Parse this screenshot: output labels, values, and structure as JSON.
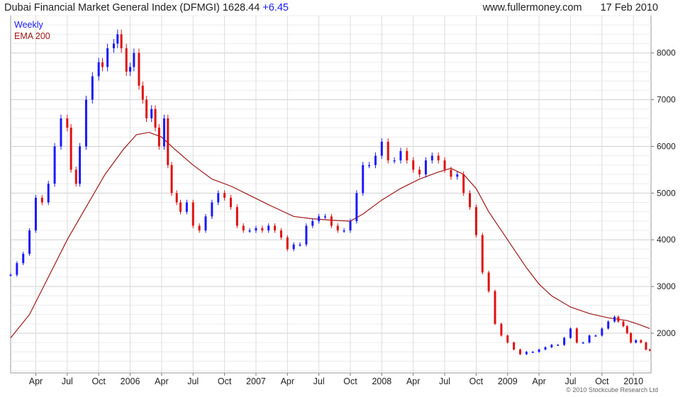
{
  "header": {
    "title": "Dubai Financial Market  General Index (DFMGI)",
    "last": "1628.44",
    "change": "+6.45",
    "site": "www.fullermoney.com",
    "date": "17 Feb 2010"
  },
  "footer": "© 2010 Stockcube Research Ltd",
  "colors": {
    "up": "#1a1aff",
    "down": "#e01010",
    "ema": "#a01818",
    "grid": "#d6d6d6",
    "legend_weekly": "#1a1aff",
    "legend_ema": "#a01818"
  },
  "chart_data": {
    "type": "line",
    "title": "Dubai Financial Market  General Index (DFMGI)",
    "legend": [
      "Weekly",
      "EMA 200"
    ],
    "legend_position": "top-left",
    "y_axis_side": "right",
    "grid": true,
    "ylim": [
      1150,
      8800
    ],
    "y_ticks": [
      2000,
      3000,
      4000,
      5000,
      6000,
      7000,
      8000
    ],
    "x_ticks": [
      {
        "label": "Apr",
        "t": 2005.25
      },
      {
        "label": "Jul",
        "t": 2005.5
      },
      {
        "label": "Oct",
        "t": 2005.75
      },
      {
        "label": "2006",
        "t": 2006.0
      },
      {
        "label": "Apr",
        "t": 2006.25
      },
      {
        "label": "Jul",
        "t": 2006.5
      },
      {
        "label": "Oct",
        "t": 2006.75
      },
      {
        "label": "2007",
        "t": 2007.0
      },
      {
        "label": "Apr",
        "t": 2007.25
      },
      {
        "label": "Jul",
        "t": 2007.5
      },
      {
        "label": "Oct",
        "t": 2007.75
      },
      {
        "label": "2008",
        "t": 2008.0
      },
      {
        "label": "Apr",
        "t": 2008.25
      },
      {
        "label": "Jul",
        "t": 2008.5
      },
      {
        "label": "Oct",
        "t": 2008.75
      },
      {
        "label": "2009",
        "t": 2009.0
      },
      {
        "label": "Apr",
        "t": 2009.25
      },
      {
        "label": "Jul",
        "t": 2009.5
      },
      {
        "label": "Oct",
        "t": 2009.75
      },
      {
        "label": "2010",
        "t": 2010.0
      }
    ],
    "x_range": [
      2005.05,
      2010.14
    ],
    "series": [
      {
        "name": "Weekly",
        "style": "ohlc-weekly",
        "points": [
          [
            2005.05,
            3250
          ],
          [
            2005.1,
            3500
          ],
          [
            2005.15,
            3700
          ],
          [
            2005.2,
            4200
          ],
          [
            2005.25,
            4900
          ],
          [
            2005.3,
            4800
          ],
          [
            2005.35,
            5200
          ],
          [
            2005.4,
            6000
          ],
          [
            2005.45,
            6600
          ],
          [
            2005.5,
            6400
          ],
          [
            2005.53,
            5500
          ],
          [
            2005.57,
            5200
          ],
          [
            2005.6,
            6000
          ],
          [
            2005.65,
            7000
          ],
          [
            2005.7,
            7500
          ],
          [
            2005.75,
            7800
          ],
          [
            2005.78,
            7700
          ],
          [
            2005.82,
            8100
          ],
          [
            2005.87,
            8200
          ],
          [
            2005.9,
            8400
          ],
          [
            2005.93,
            8100
          ],
          [
            2005.97,
            7600
          ],
          [
            2006.0,
            7700
          ],
          [
            2006.03,
            8000
          ],
          [
            2006.07,
            7300
          ],
          [
            2006.1,
            7000
          ],
          [
            2006.13,
            6600
          ],
          [
            2006.17,
            6800
          ],
          [
            2006.2,
            6400
          ],
          [
            2006.23,
            6000
          ],
          [
            2006.27,
            6600
          ],
          [
            2006.3,
            5600
          ],
          [
            2006.33,
            5000
          ],
          [
            2006.37,
            4800
          ],
          [
            2006.4,
            4600
          ],
          [
            2006.45,
            4800
          ],
          [
            2006.5,
            4300
          ],
          [
            2006.55,
            4200
          ],
          [
            2006.6,
            4500
          ],
          [
            2006.65,
            4800
          ],
          [
            2006.7,
            5000
          ],
          [
            2006.75,
            4900
          ],
          [
            2006.8,
            4700
          ],
          [
            2006.85,
            4300
          ],
          [
            2006.9,
            4200
          ],
          [
            2006.95,
            4200
          ],
          [
            2007.0,
            4250
          ],
          [
            2007.05,
            4200
          ],
          [
            2007.1,
            4300
          ],
          [
            2007.15,
            4200
          ],
          [
            2007.2,
            4050
          ],
          [
            2007.25,
            3800
          ],
          [
            2007.3,
            3900
          ],
          [
            2007.35,
            3900
          ],
          [
            2007.4,
            4300
          ],
          [
            2007.45,
            4400
          ],
          [
            2007.5,
            4500
          ],
          [
            2007.55,
            4500
          ],
          [
            2007.6,
            4300
          ],
          [
            2007.65,
            4200
          ],
          [
            2007.7,
            4200
          ],
          [
            2007.75,
            4400
          ],
          [
            2007.8,
            5000
          ],
          [
            2007.85,
            5600
          ],
          [
            2007.9,
            5600
          ],
          [
            2007.95,
            5800
          ],
          [
            2008.0,
            6100
          ],
          [
            2008.05,
            5700
          ],
          [
            2008.1,
            5700
          ],
          [
            2008.15,
            5900
          ],
          [
            2008.2,
            5700
          ],
          [
            2008.25,
            5500
          ],
          [
            2008.3,
            5400
          ],
          [
            2008.35,
            5700
          ],
          [
            2008.4,
            5800
          ],
          [
            2008.45,
            5700
          ],
          [
            2008.5,
            5500
          ],
          [
            2008.55,
            5350
          ],
          [
            2008.6,
            5400
          ],
          [
            2008.65,
            5000
          ],
          [
            2008.7,
            4700
          ],
          [
            2008.75,
            4100
          ],
          [
            2008.8,
            3300
          ],
          [
            2008.85,
            2900
          ],
          [
            2008.9,
            2200
          ],
          [
            2008.95,
            1950
          ],
          [
            2009.0,
            1800
          ],
          [
            2009.05,
            1650
          ],
          [
            2009.1,
            1550
          ],
          [
            2009.15,
            1600
          ],
          [
            2009.2,
            1600
          ],
          [
            2009.25,
            1650
          ],
          [
            2009.3,
            1700
          ],
          [
            2009.35,
            1750
          ],
          [
            2009.4,
            1750
          ],
          [
            2009.45,
            1900
          ],
          [
            2009.5,
            2100
          ],
          [
            2009.55,
            1800
          ],
          [
            2009.6,
            1800
          ],
          [
            2009.65,
            1950
          ],
          [
            2009.7,
            1950
          ],
          [
            2009.75,
            2100
          ],
          [
            2009.8,
            2250
          ],
          [
            2009.85,
            2350
          ],
          [
            2009.88,
            2250
          ],
          [
            2009.92,
            2150
          ],
          [
            2009.95,
            2000
          ],
          [
            2009.98,
            1800
          ],
          [
            2010.02,
            1850
          ],
          [
            2010.06,
            1800
          ],
          [
            2010.1,
            1650
          ],
          [
            2010.13,
            1628
          ]
        ]
      },
      {
        "name": "EMA 200",
        "style": "line",
        "points": [
          [
            2005.05,
            1900
          ],
          [
            2005.2,
            2400
          ],
          [
            2005.35,
            3200
          ],
          [
            2005.5,
            4000
          ],
          [
            2005.65,
            4700
          ],
          [
            2005.8,
            5400
          ],
          [
            2005.95,
            5950
          ],
          [
            2006.05,
            6250
          ],
          [
            2006.15,
            6300
          ],
          [
            2006.25,
            6200
          ],
          [
            2006.35,
            5950
          ],
          [
            2006.5,
            5600
          ],
          [
            2006.65,
            5300
          ],
          [
            2006.8,
            5150
          ],
          [
            2006.95,
            4950
          ],
          [
            2007.1,
            4750
          ],
          [
            2007.3,
            4500
          ],
          [
            2007.45,
            4450
          ],
          [
            2007.6,
            4420
          ],
          [
            2007.75,
            4400
          ],
          [
            2007.85,
            4550
          ],
          [
            2008.0,
            4850
          ],
          [
            2008.15,
            5100
          ],
          [
            2008.3,
            5300
          ],
          [
            2008.45,
            5450
          ],
          [
            2008.55,
            5530
          ],
          [
            2008.65,
            5400
          ],
          [
            2008.75,
            5100
          ],
          [
            2008.85,
            4600
          ],
          [
            2008.95,
            4200
          ],
          [
            2009.05,
            3800
          ],
          [
            2009.15,
            3400
          ],
          [
            2009.25,
            3050
          ],
          [
            2009.35,
            2800
          ],
          [
            2009.5,
            2560
          ],
          [
            2009.65,
            2420
          ],
          [
            2009.8,
            2330
          ],
          [
            2009.95,
            2270
          ],
          [
            2010.05,
            2180
          ],
          [
            2010.13,
            2100
          ]
        ]
      }
    ]
  }
}
